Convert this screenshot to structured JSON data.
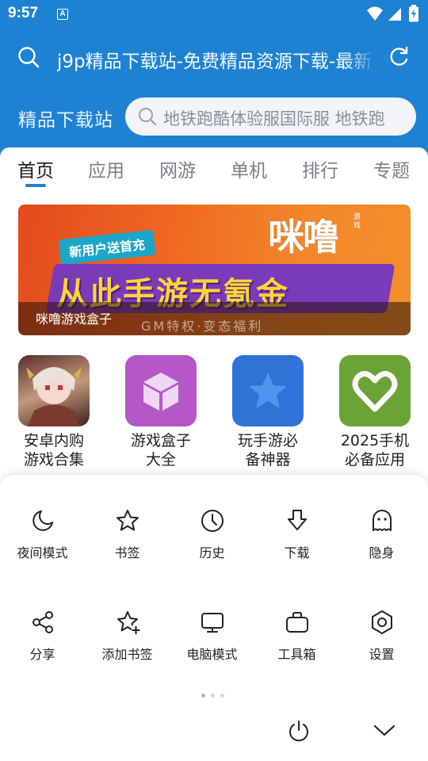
{
  "status_bar": {
    "time": "9:57",
    "notification_icon": "A",
    "icons": [
      "wifi-icon",
      "cell-signal-icon",
      "battery-charging-icon"
    ]
  },
  "browser": {
    "url_text": "j9p精品下载站-免费精品资源下载-最新",
    "icons": [
      "search-icon",
      "reload-icon"
    ]
  },
  "site": {
    "title": "精品下载站",
    "search_placeholder": "地铁跑酷体验服国际服 地铁跑"
  },
  "tabs": [
    {
      "label": "首页",
      "active": true
    },
    {
      "label": "应用",
      "active": false
    },
    {
      "label": "网游",
      "active": false
    },
    {
      "label": "单机",
      "active": false
    },
    {
      "label": "排行",
      "active": false
    },
    {
      "label": "专题",
      "active": false
    }
  ],
  "banner": {
    "badge": "新用户送首充",
    "slogan": "从此手游无氪金",
    "brand": "咪噜",
    "brand_sub": "游戏",
    "tagline": "GM特权·变态福利",
    "caption": "咪噜游戏盒子"
  },
  "apps": [
    {
      "name_line1": "安卓内购",
      "name_line2": "游戏合集",
      "icon": "game-character-icon",
      "color": "#6b3a3a"
    },
    {
      "name_line1": "游戏盒子",
      "name_line2": "大全",
      "icon": "cube-icon",
      "color": "#b457c7"
    },
    {
      "name_line1": "玩手游必",
      "name_line2": "备神器",
      "icon": "star-icon",
      "color": "#2f73d6"
    },
    {
      "name_line1": "2025手机",
      "name_line2": "必备应用",
      "icon": "heart-icon",
      "color": "#6aa437"
    }
  ],
  "menu": {
    "row1": [
      {
        "label": "夜间模式",
        "icon": "moon-icon"
      },
      {
        "label": "书签",
        "icon": "star-outline-icon"
      },
      {
        "label": "历史",
        "icon": "clock-icon"
      },
      {
        "label": "下载",
        "icon": "download-icon"
      },
      {
        "label": "隐身",
        "icon": "ghost-icon"
      }
    ],
    "row2": [
      {
        "label": "分享",
        "icon": "share-icon"
      },
      {
        "label": "添加书签",
        "icon": "add-bookmark-icon"
      },
      {
        "label": "电脑模式",
        "icon": "monitor-icon"
      },
      {
        "label": "工具箱",
        "icon": "toolbox-icon"
      },
      {
        "label": "设置",
        "icon": "settings-icon"
      }
    ],
    "page_indicator": {
      "current": 1,
      "total": 3
    },
    "bottom_icons": [
      "power-icon",
      "chevron-down-icon"
    ]
  },
  "colors": {
    "accent": "#1e82d2",
    "text": "#222222",
    "muted": "#7a7f86",
    "sheet": "#ffffff"
  }
}
